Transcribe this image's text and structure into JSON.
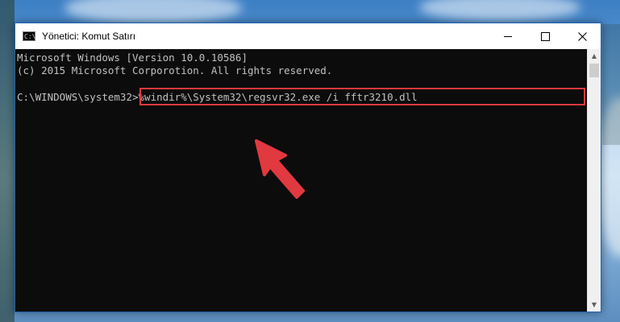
{
  "window": {
    "title": "Yönetici: Komut Satırı",
    "icon": "cmd-icon",
    "controls": {
      "minimize": "minimize-icon",
      "maximize": "maximize-icon",
      "close": "close-icon"
    }
  },
  "console": {
    "lines": [
      "Microsoft Windows [Version 10.0.10586]",
      "(c) 2015 Microsoft Corporotion. All rights reserved."
    ],
    "prompt": "C:\\WINDOWS\\system32>",
    "command": "%windir%\\System32\\regsvr32.exe /i fftr3210.dll"
  },
  "annotation": {
    "highlight_color": "#e0393f",
    "arrow_color": "#e0393f"
  },
  "colors": {
    "console_bg": "#0c0c0c",
    "console_text": "#c0c0c0",
    "window_border": "#1e63b0"
  }
}
